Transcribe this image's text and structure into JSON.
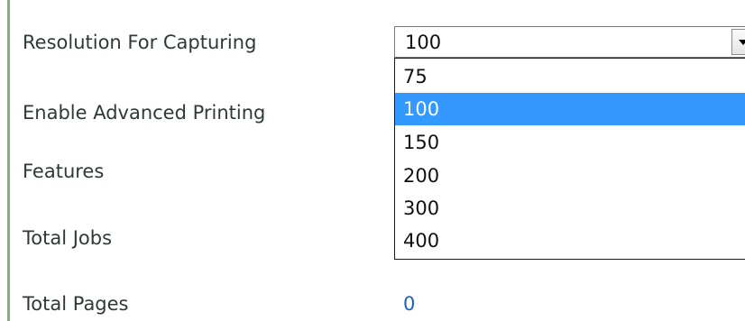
{
  "settings": {
    "resolution_label": "Resolution For Capturing",
    "advanced_printing_label": "Enable Advanced Printing",
    "features_label": "Features",
    "total_jobs_label": "Total Jobs",
    "total_pages_label": "Total Pages",
    "total_pages_value": "0"
  },
  "resolution_dropdown": {
    "selected": "100",
    "options": [
      "75",
      "100",
      "150",
      "200",
      "300",
      "400"
    ],
    "highlighted_option": "100",
    "icon": "chevron-down-icon"
  },
  "colors": {
    "highlight": "#3399ff",
    "value_text": "#1f5fbf"
  }
}
